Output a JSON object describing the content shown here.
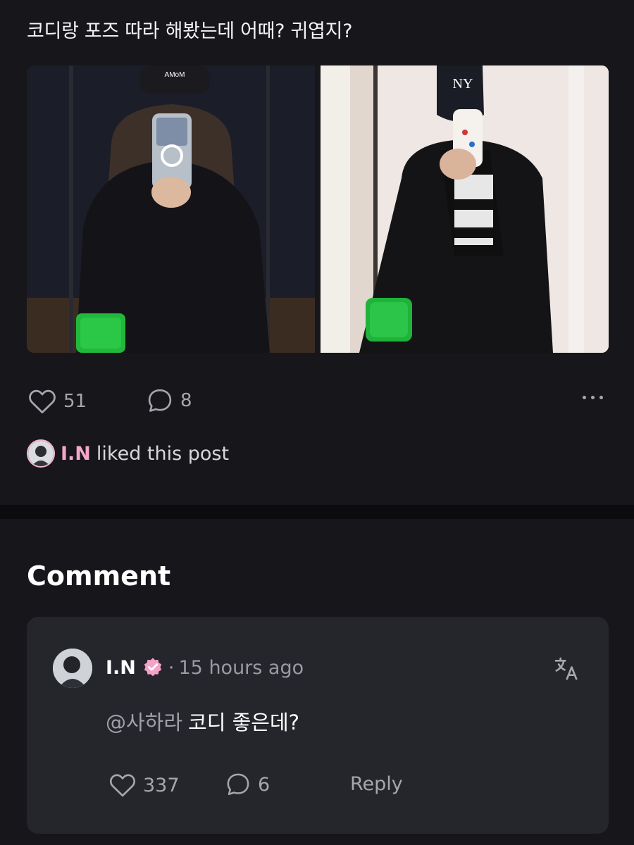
{
  "post": {
    "text": "코디랑 포즈 따라 해봤는데 어때? 귀엽지?",
    "images": [
      {
        "alt": "mirror selfie wearing black coat with AMoM cap and green bag",
        "cap_text": "AMoM"
      },
      {
        "alt": "mirror selfie wearing black coat, NY cap, scarf and green bag",
        "cap_text": "NY"
      }
    ],
    "likes": "51",
    "comments": "8",
    "liked_by": {
      "name": "I.N",
      "text": "liked this post"
    }
  },
  "comments_section": {
    "heading": "Comment",
    "comment": {
      "author": "I.N",
      "separator": "·",
      "time": "15 hours ago",
      "mention": "@사하라",
      "body": "코디 좋은데?",
      "likes": "337",
      "replies": "6",
      "reply_label": "Reply"
    }
  },
  "colors": {
    "background": "#17161b",
    "card": "#25252c",
    "accent_pink": "#f5a7c7",
    "muted": "#a6a6ad"
  },
  "icons": [
    "heart-icon",
    "comment-bubble-icon",
    "more-dots-icon",
    "verified-badge-icon",
    "translate-icon"
  ]
}
